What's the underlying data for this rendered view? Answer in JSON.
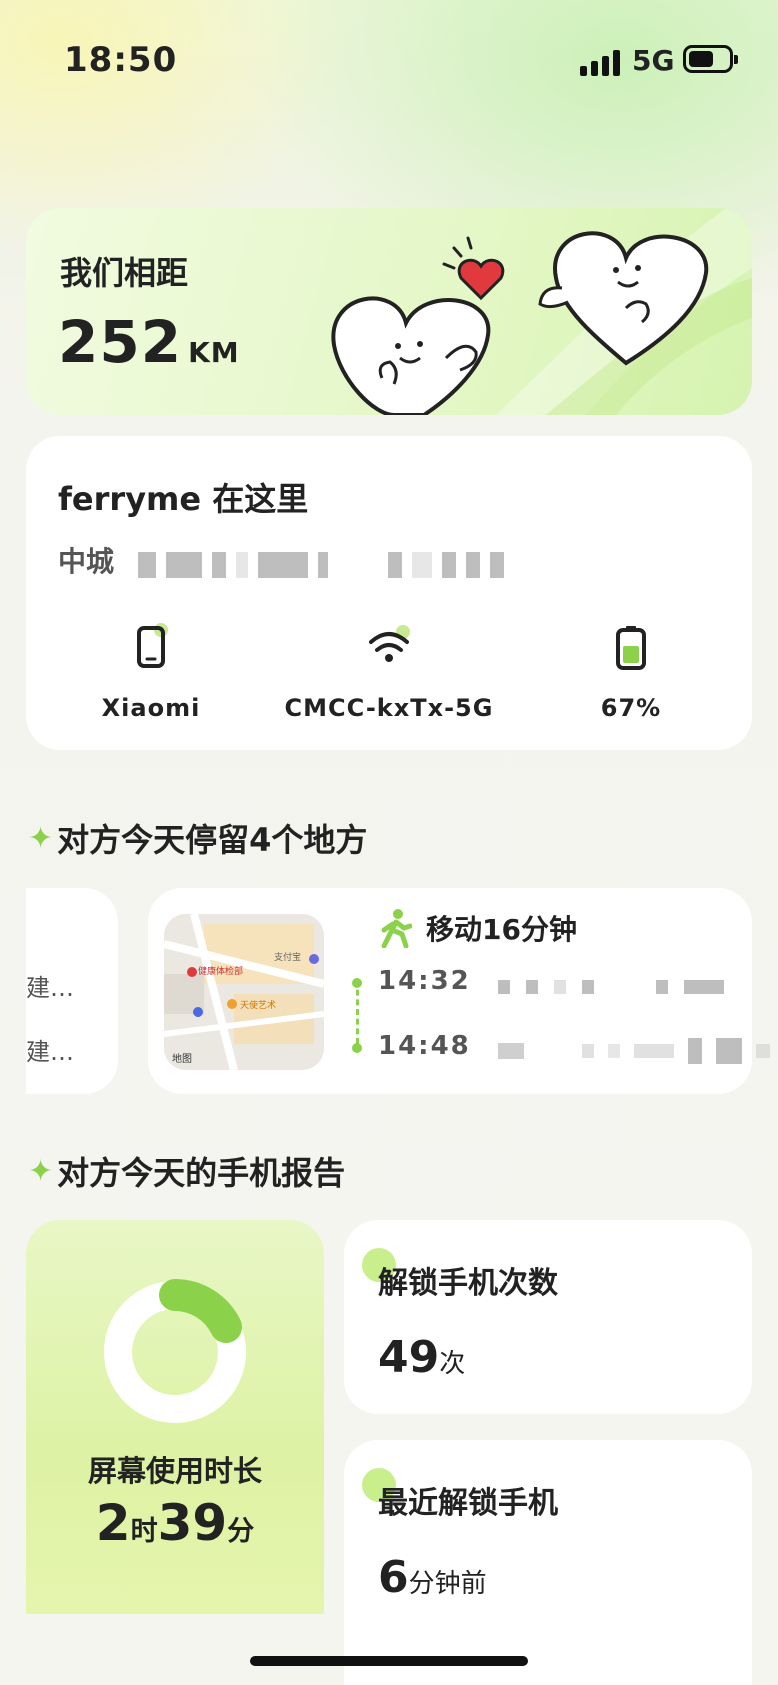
{
  "status_bar": {
    "time": "18:50",
    "network": "5G",
    "signal_icon": "cellular-signal-icon",
    "battery_icon": "battery-icon"
  },
  "distance": {
    "title": "我们相距",
    "value": "252",
    "unit": "KM"
  },
  "location": {
    "name": "ferryme 在这里",
    "address_visible": "中城",
    "devices": [
      {
        "icon": "phone-icon",
        "label": "Xiaomi"
      },
      {
        "icon": "wifi-icon",
        "label": "CMCC-kxTx-5G"
      },
      {
        "icon": "battery-icon",
        "label": "67%",
        "level": 0.67
      }
    ]
  },
  "stops": {
    "section_title": "对方今天停留4个地方",
    "prev_card": {
      "line1": "建…",
      "line2": "建…"
    },
    "card": {
      "map_caption": "地图",
      "map_labels": [
        "健康体检部",
        "支付宝",
        "天使艺术"
      ],
      "move_label": "移动16分钟",
      "times": [
        "14:32",
        "14:48"
      ]
    }
  },
  "report": {
    "section_title": "对方今天的手机报告",
    "screen_time": {
      "label": "屏幕使用时长",
      "hours": "2",
      "hours_unit": "时",
      "minutes": "39",
      "minutes_unit": "分"
    },
    "unlock_count": {
      "label": "解锁手机次数",
      "value": "49",
      "unit": "次"
    },
    "last_unlock": {
      "label": "最近解锁手机",
      "value": "6",
      "unit": "分钟前"
    }
  },
  "colors": {
    "accent": "#8bd14a",
    "heart": "#e0393e",
    "card_bg": "#ffffff"
  }
}
